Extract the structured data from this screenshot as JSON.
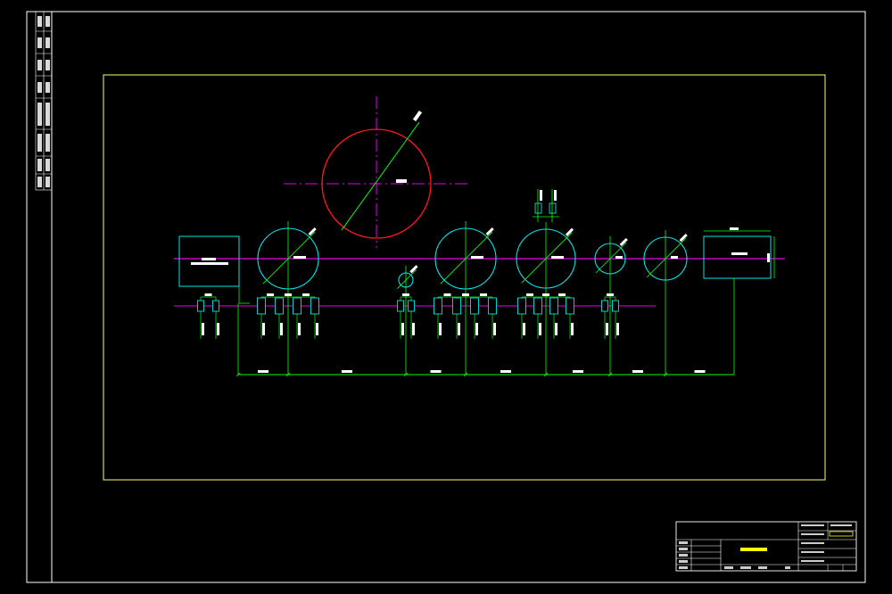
{
  "colors": {
    "background": "#000000",
    "frame": "#ffffff",
    "viewport_border": "#ffff66",
    "circle": "#00e5e5",
    "main_circle": "#ff1a1a",
    "centerline": "#e600e6",
    "dimension": "#00ff00",
    "text": "#ffffff",
    "highlight": "#ffff00"
  },
  "drawing": {
    "title": "",
    "main_unit_label": "",
    "left_box_label": "",
    "right_box_label": ""
  }
}
